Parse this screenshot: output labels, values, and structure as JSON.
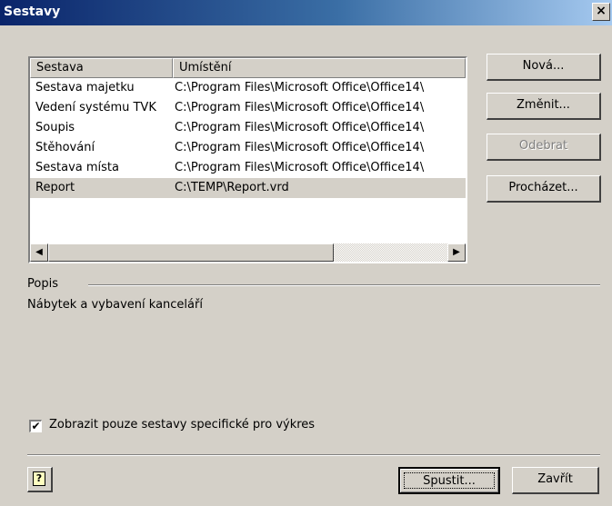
{
  "window": {
    "title": "Sestavy",
    "close_glyph": "×"
  },
  "list": {
    "columns": [
      "Sestava",
      "Umístění"
    ],
    "rows": [
      {
        "name": "Sestava majetku",
        "location": "C:\\Program Files\\Microsoft Office\\Office14\\"
      },
      {
        "name": "Vedení systému TVK",
        "location": "C:\\Program Files\\Microsoft Office\\Office14\\"
      },
      {
        "name": "Soupis",
        "location": "C:\\Program Files\\Microsoft Office\\Office14\\"
      },
      {
        "name": "Stěhování",
        "location": "C:\\Program Files\\Microsoft Office\\Office14\\"
      },
      {
        "name": "Sestava místa",
        "location": "C:\\Program Files\\Microsoft Office\\Office14\\"
      },
      {
        "name": "Report",
        "location": "C:\\TEMP\\Report.vrd"
      }
    ],
    "selected_index": 5
  },
  "buttons": {
    "new": "Nová...",
    "edit": "Změnit...",
    "remove": "Odebrat",
    "browse": "Procházet...",
    "run": "Spustit...",
    "close": "Zavřít"
  },
  "description": {
    "label": "Popis",
    "text": "Nábytek a vybavení kanceláří"
  },
  "checkbox": {
    "label": "Zobrazit pouze sestavy specifické pro výkres",
    "checked": true,
    "mark": "✔"
  },
  "help": {
    "glyph": "?"
  },
  "scroll_glyphs": {
    "left": "◀",
    "right": "▶"
  }
}
